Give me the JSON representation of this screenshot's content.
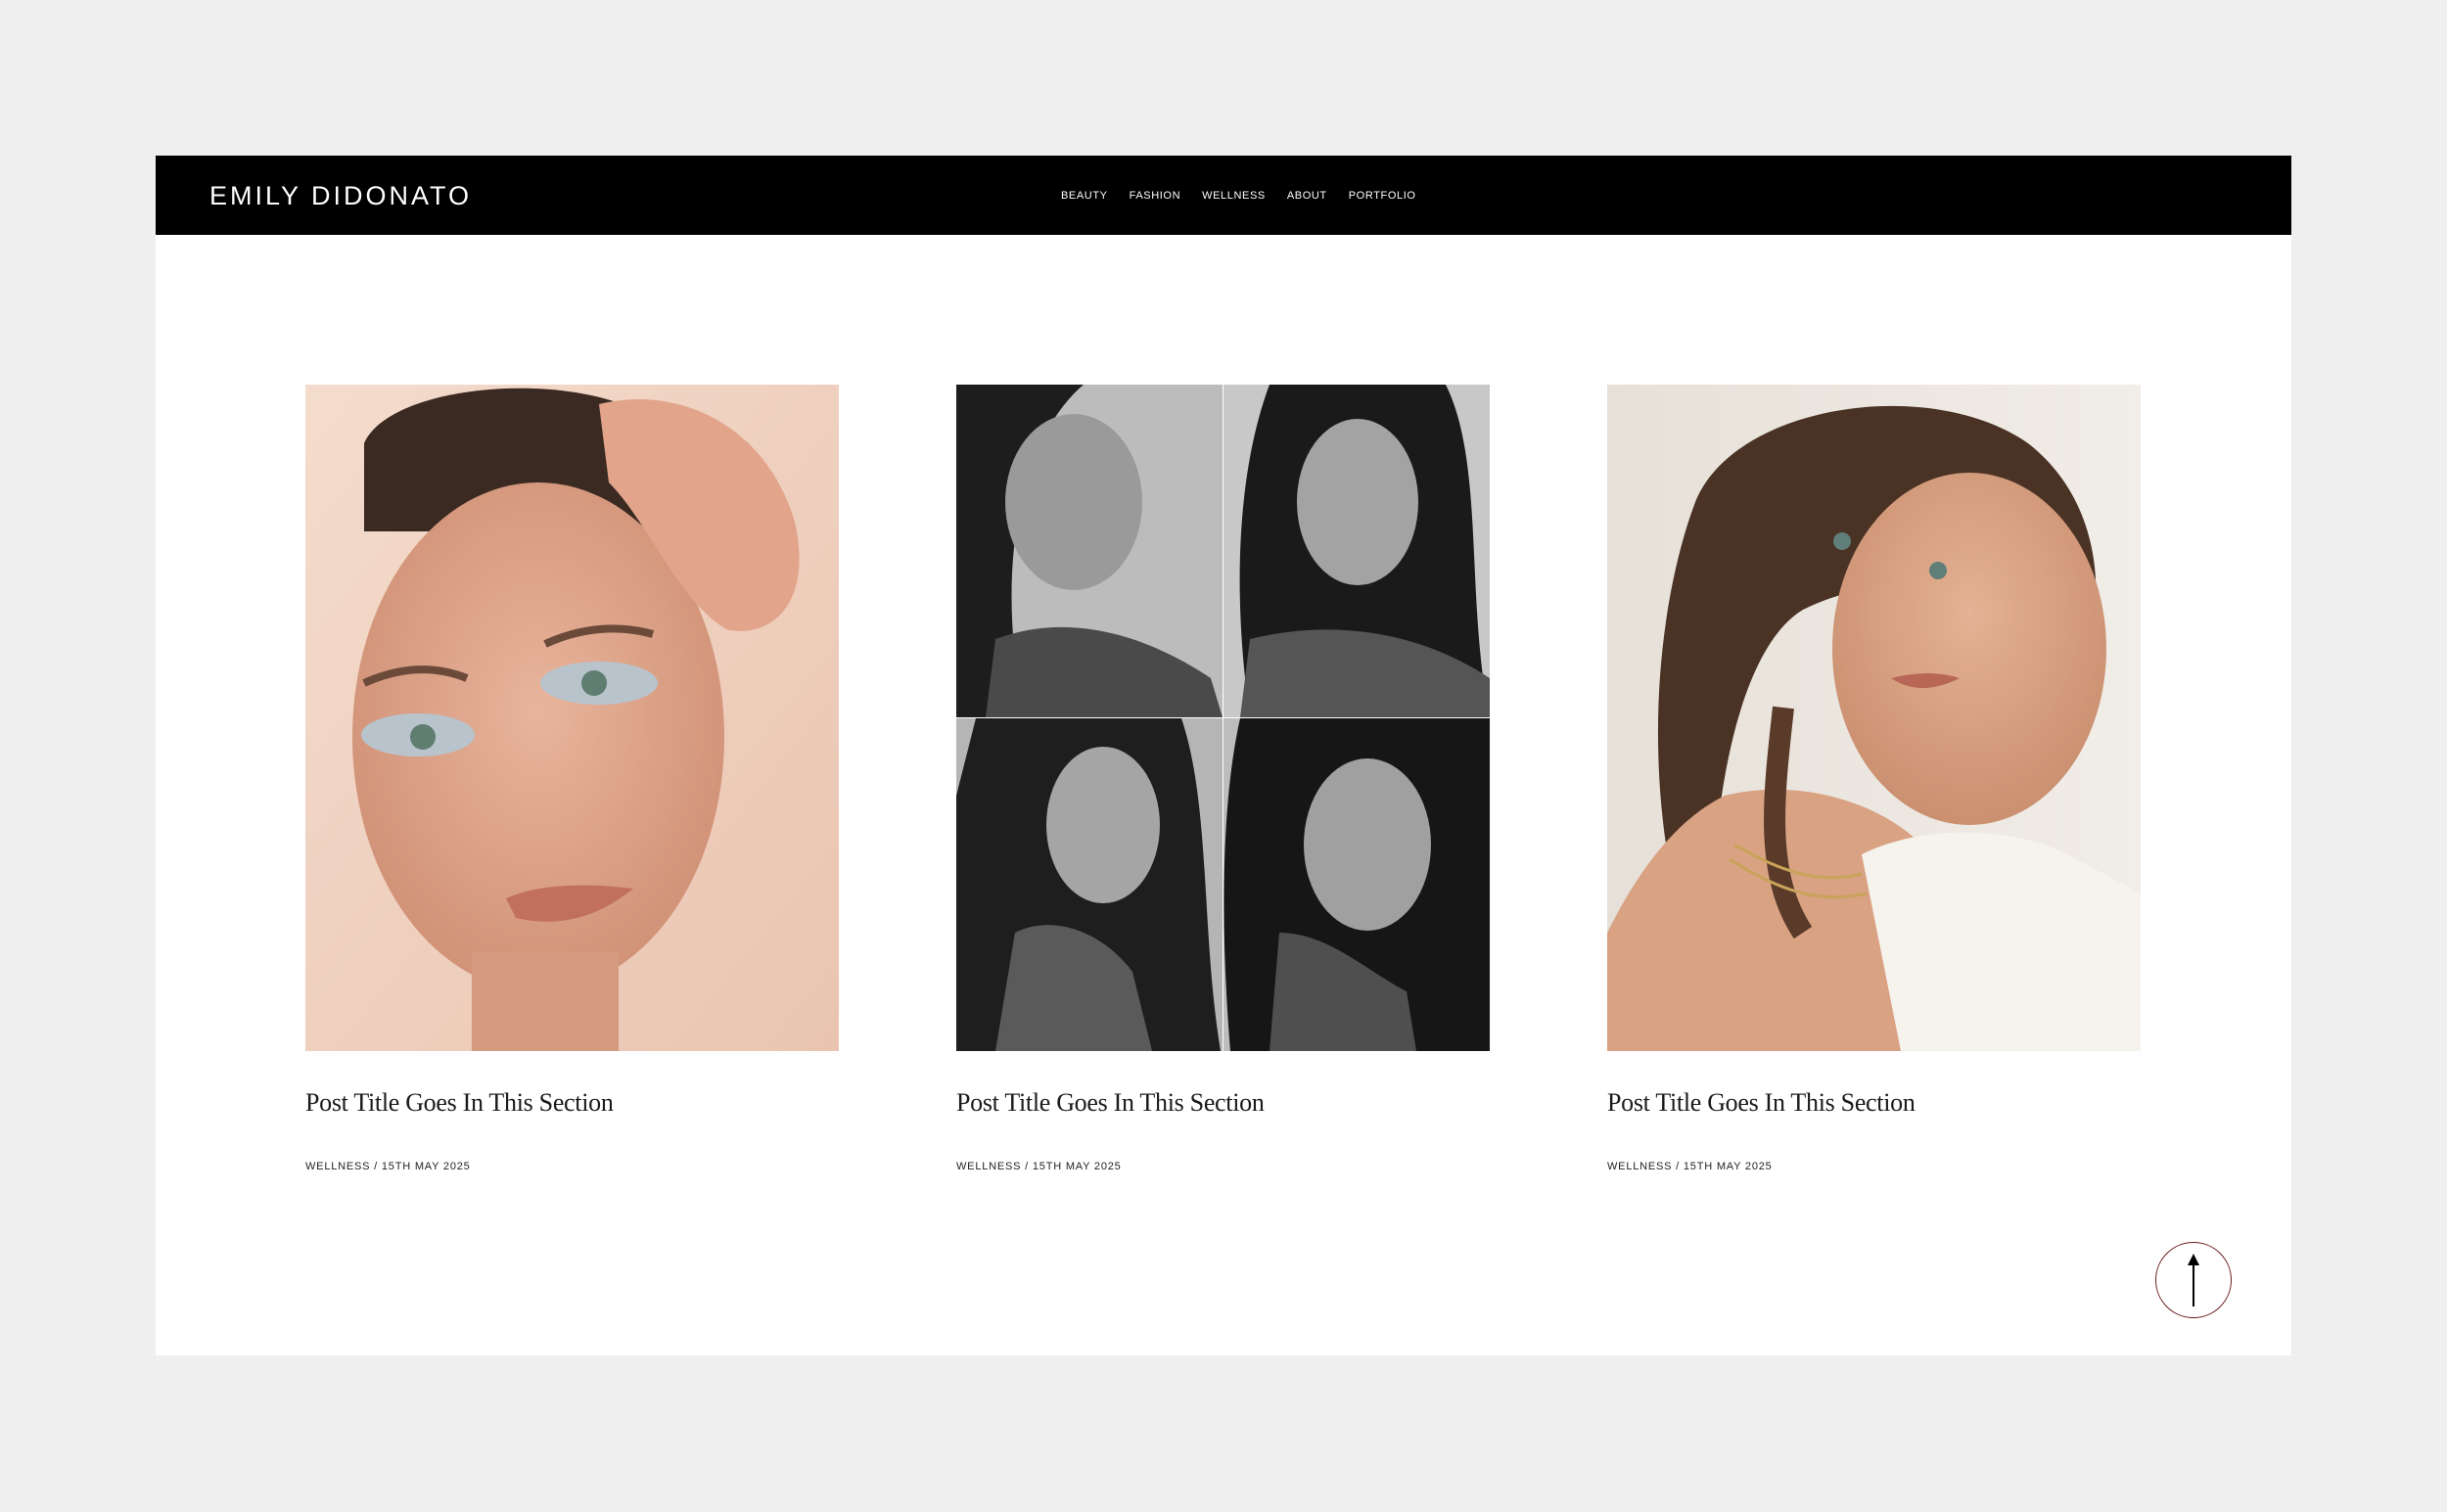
{
  "header": {
    "logo": "EMILY DIDONATO",
    "nav": [
      "BEAUTY",
      "FASHION",
      "WELLNESS",
      "ABOUT",
      "PORTFOLIO"
    ]
  },
  "posts": [
    {
      "title": "Post Title Goes In This Section",
      "meta": "WELLNESS / 15TH MAY 2025"
    },
    {
      "title": "Post Title Goes In This Section",
      "meta": "WELLNESS / 15TH MAY 2025"
    },
    {
      "title": "Post Title Goes In This Section",
      "meta": "WELLNESS / 15TH MAY 2025"
    }
  ],
  "colors": {
    "page_background": "#efefef",
    "header_background": "#000000",
    "content_background": "#ffffff",
    "back_to_top_border": "#6b1d1d"
  },
  "icons": {
    "back_to_top": "arrow-up-icon"
  }
}
